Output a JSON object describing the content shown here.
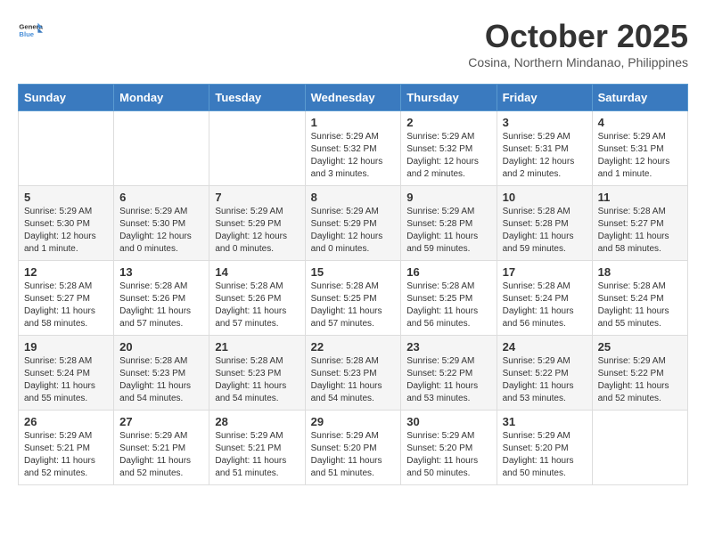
{
  "header": {
    "logo_general": "General",
    "logo_blue": "Blue",
    "month": "October 2025",
    "location": "Cosina, Northern Mindanao, Philippines"
  },
  "weekdays": [
    "Sunday",
    "Monday",
    "Tuesday",
    "Wednesday",
    "Thursday",
    "Friday",
    "Saturday"
  ],
  "weeks": [
    [
      {
        "day": "",
        "info": ""
      },
      {
        "day": "",
        "info": ""
      },
      {
        "day": "",
        "info": ""
      },
      {
        "day": "1",
        "info": "Sunrise: 5:29 AM\nSunset: 5:32 PM\nDaylight: 12 hours and 3 minutes."
      },
      {
        "day": "2",
        "info": "Sunrise: 5:29 AM\nSunset: 5:32 PM\nDaylight: 12 hours and 2 minutes."
      },
      {
        "day": "3",
        "info": "Sunrise: 5:29 AM\nSunset: 5:31 PM\nDaylight: 12 hours and 2 minutes."
      },
      {
        "day": "4",
        "info": "Sunrise: 5:29 AM\nSunset: 5:31 PM\nDaylight: 12 hours and 1 minute."
      }
    ],
    [
      {
        "day": "5",
        "info": "Sunrise: 5:29 AM\nSunset: 5:30 PM\nDaylight: 12 hours and 1 minute."
      },
      {
        "day": "6",
        "info": "Sunrise: 5:29 AM\nSunset: 5:30 PM\nDaylight: 12 hours and 0 minutes."
      },
      {
        "day": "7",
        "info": "Sunrise: 5:29 AM\nSunset: 5:29 PM\nDaylight: 12 hours and 0 minutes."
      },
      {
        "day": "8",
        "info": "Sunrise: 5:29 AM\nSunset: 5:29 PM\nDaylight: 12 hours and 0 minutes."
      },
      {
        "day": "9",
        "info": "Sunrise: 5:29 AM\nSunset: 5:28 PM\nDaylight: 11 hours and 59 minutes."
      },
      {
        "day": "10",
        "info": "Sunrise: 5:28 AM\nSunset: 5:28 PM\nDaylight: 11 hours and 59 minutes."
      },
      {
        "day": "11",
        "info": "Sunrise: 5:28 AM\nSunset: 5:27 PM\nDaylight: 11 hours and 58 minutes."
      }
    ],
    [
      {
        "day": "12",
        "info": "Sunrise: 5:28 AM\nSunset: 5:27 PM\nDaylight: 11 hours and 58 minutes."
      },
      {
        "day": "13",
        "info": "Sunrise: 5:28 AM\nSunset: 5:26 PM\nDaylight: 11 hours and 57 minutes."
      },
      {
        "day": "14",
        "info": "Sunrise: 5:28 AM\nSunset: 5:26 PM\nDaylight: 11 hours and 57 minutes."
      },
      {
        "day": "15",
        "info": "Sunrise: 5:28 AM\nSunset: 5:25 PM\nDaylight: 11 hours and 57 minutes."
      },
      {
        "day": "16",
        "info": "Sunrise: 5:28 AM\nSunset: 5:25 PM\nDaylight: 11 hours and 56 minutes."
      },
      {
        "day": "17",
        "info": "Sunrise: 5:28 AM\nSunset: 5:24 PM\nDaylight: 11 hours and 56 minutes."
      },
      {
        "day": "18",
        "info": "Sunrise: 5:28 AM\nSunset: 5:24 PM\nDaylight: 11 hours and 55 minutes."
      }
    ],
    [
      {
        "day": "19",
        "info": "Sunrise: 5:28 AM\nSunset: 5:24 PM\nDaylight: 11 hours and 55 minutes."
      },
      {
        "day": "20",
        "info": "Sunrise: 5:28 AM\nSunset: 5:23 PM\nDaylight: 11 hours and 54 minutes."
      },
      {
        "day": "21",
        "info": "Sunrise: 5:28 AM\nSunset: 5:23 PM\nDaylight: 11 hours and 54 minutes."
      },
      {
        "day": "22",
        "info": "Sunrise: 5:28 AM\nSunset: 5:23 PM\nDaylight: 11 hours and 54 minutes."
      },
      {
        "day": "23",
        "info": "Sunrise: 5:29 AM\nSunset: 5:22 PM\nDaylight: 11 hours and 53 minutes."
      },
      {
        "day": "24",
        "info": "Sunrise: 5:29 AM\nSunset: 5:22 PM\nDaylight: 11 hours and 53 minutes."
      },
      {
        "day": "25",
        "info": "Sunrise: 5:29 AM\nSunset: 5:22 PM\nDaylight: 11 hours and 52 minutes."
      }
    ],
    [
      {
        "day": "26",
        "info": "Sunrise: 5:29 AM\nSunset: 5:21 PM\nDaylight: 11 hours and 52 minutes."
      },
      {
        "day": "27",
        "info": "Sunrise: 5:29 AM\nSunset: 5:21 PM\nDaylight: 11 hours and 52 minutes."
      },
      {
        "day": "28",
        "info": "Sunrise: 5:29 AM\nSunset: 5:21 PM\nDaylight: 11 hours and 51 minutes."
      },
      {
        "day": "29",
        "info": "Sunrise: 5:29 AM\nSunset: 5:20 PM\nDaylight: 11 hours and 51 minutes."
      },
      {
        "day": "30",
        "info": "Sunrise: 5:29 AM\nSunset: 5:20 PM\nDaylight: 11 hours and 50 minutes."
      },
      {
        "day": "31",
        "info": "Sunrise: 5:29 AM\nSunset: 5:20 PM\nDaylight: 11 hours and 50 minutes."
      },
      {
        "day": "",
        "info": ""
      }
    ]
  ]
}
